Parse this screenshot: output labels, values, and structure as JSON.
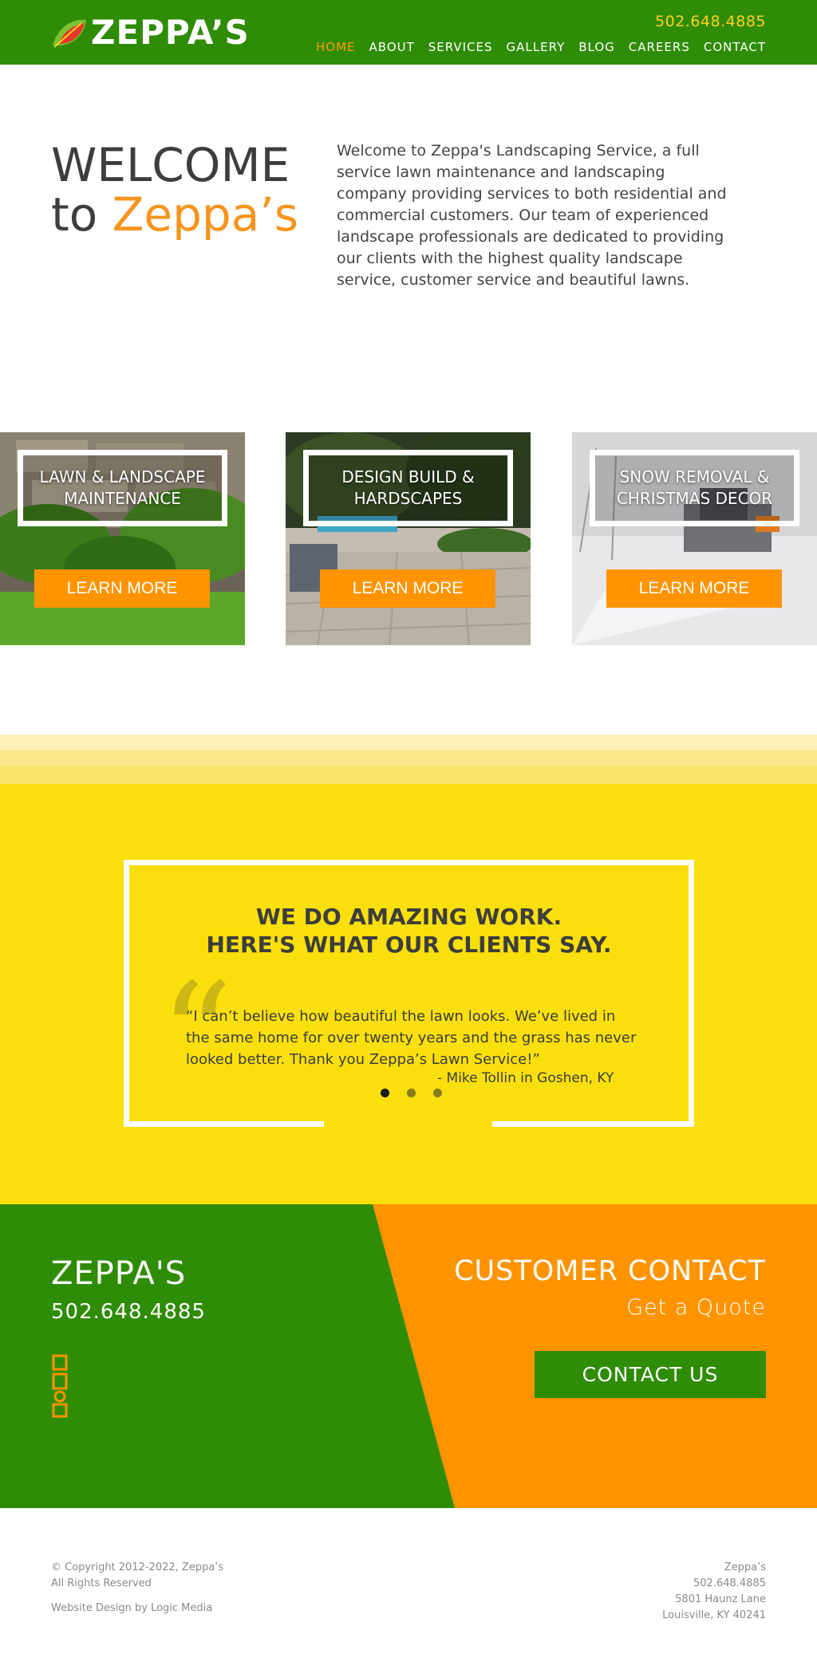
{
  "header": {
    "logo_text": "ZEPPA’S",
    "phone": "502.648.4885",
    "nav": [
      {
        "label": "HOME",
        "active": true
      },
      {
        "label": "ABOUT",
        "active": false
      },
      {
        "label": "SERVICES",
        "active": false
      },
      {
        "label": "GALLERY",
        "active": false
      },
      {
        "label": "BLOG",
        "active": false
      },
      {
        "label": "CAREERS",
        "active": false
      },
      {
        "label": "CONTACT",
        "active": false
      }
    ]
  },
  "welcome": {
    "line1": "WELCOME",
    "line2_prefix": "to",
    "line2_accent": "Zeppa’s",
    "body": "Welcome to Zeppa's Landscaping Service, a full service lawn maintenance and landscaping company providing services to both residential and commercial customers. Our team of experienced landscape professionals are dedicated to providing our clients with the highest quality landscape service, customer service and beautiful lawns."
  },
  "services": [
    {
      "title_line1": "LAWN & LANDSCAPE",
      "title_line2": "MAINTENANCE",
      "button": "LEARN MORE"
    },
    {
      "title_line1": "DESIGN BUILD &",
      "title_line2": "HARDSCAPES",
      "button": "LEARN MORE"
    },
    {
      "title_line1": "SNOW REMOVAL &",
      "title_line2": "CHRISTMAS DECOR",
      "button": "LEARN MORE"
    }
  ],
  "testimonials": {
    "heading_line1": "WE DO AMAZING WORK.",
    "heading_line2": "HERE'S WHAT OUR CLIENTS SAY.",
    "quote_mark": "“",
    "quote": "“I can’t believe how beautiful the lawn looks. We’ve lived in the same home for over twenty years and the grass has never looked better. Thank you Zeppa’s Lawn Service!”",
    "author": "- Mike Tollin in Goshen, KY",
    "dot_count": 3,
    "active_dot": 0
  },
  "contact_band": {
    "brand": "ZEPPA'S",
    "phone": "502.648.4885",
    "social_icon": "houzz-icon",
    "heading": "CUSTOMER CONTACT",
    "quote_link": "Get a Quote",
    "button": "CONTACT US"
  },
  "footer": {
    "copyright_line1": "© Copyright 2012-2022, Zeppa’s",
    "copyright_line2": "All Rights Reserved",
    "design_credit": "Website Design by Logic Media",
    "address_name": "Zeppa’s",
    "address_phone": "502.648.4885",
    "address_street": "5801 Haunz Lane",
    "address_city": "Louisville, KY 40241"
  },
  "colors": {
    "green": "#2f8c06",
    "orange": "#ff9400",
    "yellow": "#f9df0c",
    "phone_yellow": "#ffd21a",
    "text_dark": "#3d3d3d"
  }
}
